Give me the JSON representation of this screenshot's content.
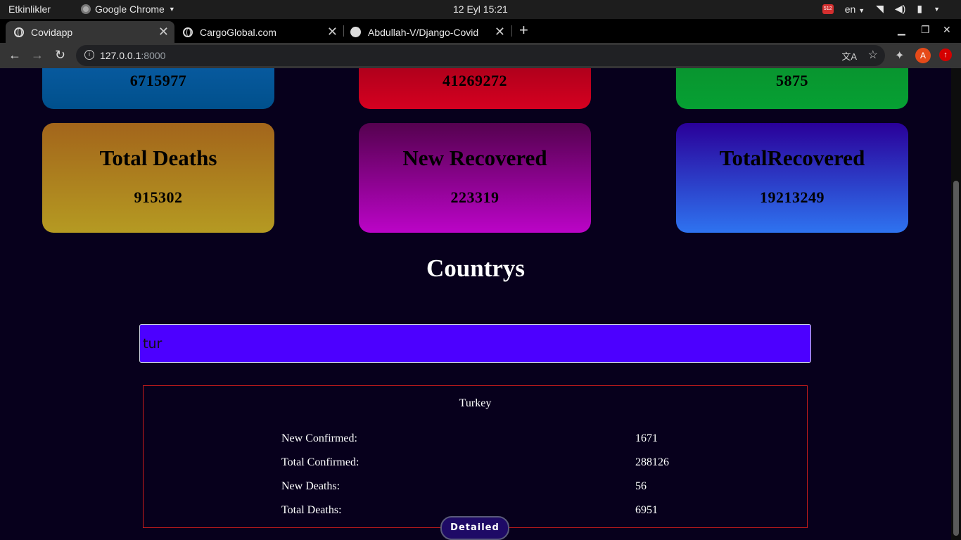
{
  "os": {
    "activities": "Etkinlikler",
    "app_name": "Google Chrome",
    "clock": "12 Eyl  15:21",
    "notif_count": "512",
    "lang": "en"
  },
  "browser": {
    "tabs": [
      {
        "title": "Covidapp",
        "active": true
      },
      {
        "title": "CargoGlobal.com",
        "active": false
      },
      {
        "title": "Abdullah-V/Django-Covid",
        "active": false
      }
    ],
    "url_host": "127.0.0.1",
    "url_port": ":8000",
    "profile_initial": "A"
  },
  "stats": {
    "top": [
      {
        "value": "6715977",
        "color": "#00508c"
      },
      {
        "value": "41269272",
        "color": "#d50020"
      },
      {
        "value": "5875",
        "color": "#06a033"
      }
    ],
    "cards": [
      {
        "title": "Total Deaths",
        "value": "915302"
      },
      {
        "title": "New Recovered",
        "value": "223319"
      },
      {
        "title": "TotalRecovered",
        "value": "19213249"
      }
    ]
  },
  "countries": {
    "heading": "Countrys",
    "search_value": "tur",
    "result": {
      "country": "Turkey",
      "rows": [
        {
          "label": "New Confirmed:",
          "value": "1671"
        },
        {
          "label": "Total Confirmed:",
          "value": "288126"
        },
        {
          "label": "New Deaths:",
          "value": "56"
        },
        {
          "label": "Total Deaths:",
          "value": "6951"
        }
      ],
      "button": "Detailed"
    }
  }
}
